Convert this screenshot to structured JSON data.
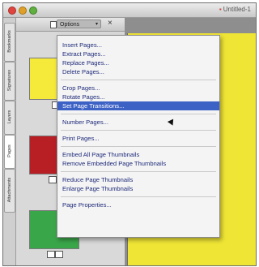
{
  "window": {
    "title": "Untitled-1"
  },
  "panel": {
    "options_label": "Options",
    "caret": "▾",
    "close_glyph": "×"
  },
  "side_tabs": [
    "Bookmarks",
    "Signatures",
    "Layers",
    "Pages",
    "Attachments"
  ],
  "menu": {
    "groups": [
      [
        "Insert Pages...",
        "Extract Pages...",
        "Replace Pages...",
        "Delete Pages..."
      ],
      [
        "Crop Pages...",
        "Rotate Pages...",
        "Set Page Transitions..."
      ],
      [
        "Number Pages..."
      ],
      [
        "Print Pages..."
      ],
      [
        "Embed All Page Thumbnails",
        "Remove Embedded Page Thumbnails"
      ],
      [
        "Reduce Page Thumbnails",
        "Enlarge Page Thumbnails"
      ],
      [
        "Page Properties..."
      ]
    ],
    "highlighted": "Set Page Transitions..."
  },
  "colors": {
    "page_yellow": "#efe535",
    "thumb_red": "#b81f25",
    "thumb_green": "#3aa64a",
    "highlight": "#3d62c6"
  }
}
